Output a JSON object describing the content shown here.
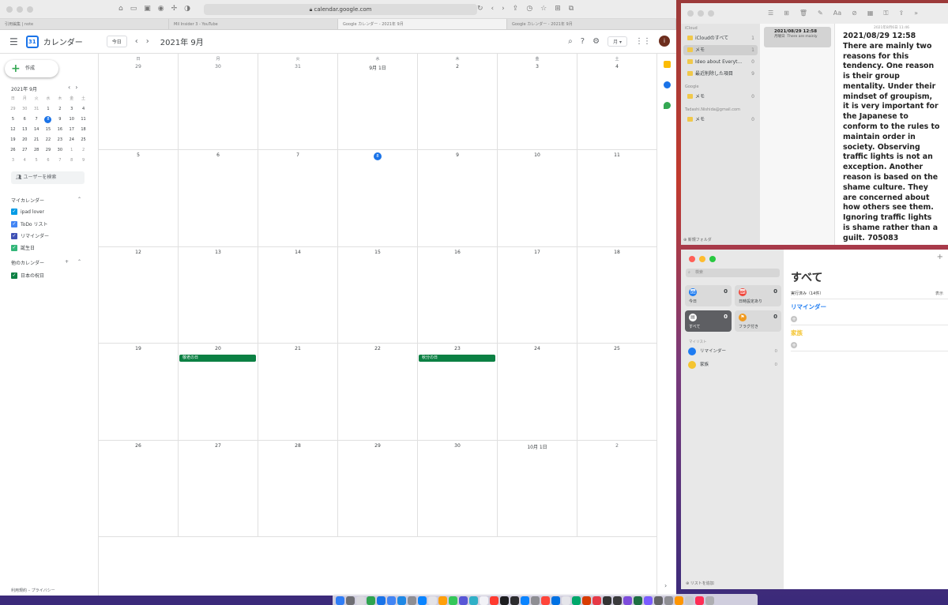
{
  "browser": {
    "url": "calendar.google.com",
    "tabs": [
      {
        "label": "引用編集 | note"
      },
      {
        "label": "Mil Insider 3 - YouTube"
      },
      {
        "label": "Google カレンダー - 2021年 9月"
      },
      {
        "label": "Google カレンダー - 2021年 9月"
      }
    ]
  },
  "gcal": {
    "app_title": "カレンダー",
    "logo_day": "31",
    "today_button": "今日",
    "month_title": "2021年 9月",
    "view_label": "月",
    "avatar_letter": "i",
    "create_label": "作成",
    "mini_title": "2021年 9月",
    "mini_days": [
      "日",
      "月",
      "火",
      "水",
      "木",
      "金",
      "土"
    ],
    "mini_weeks": [
      [
        "29",
        "30",
        "31",
        "1",
        "2",
        "3",
        "4"
      ],
      [
        "5",
        "6",
        "7",
        "8",
        "9",
        "10",
        "11"
      ],
      [
        "12",
        "13",
        "14",
        "15",
        "16",
        "17",
        "18"
      ],
      [
        "19",
        "20",
        "21",
        "22",
        "23",
        "24",
        "25"
      ],
      [
        "26",
        "27",
        "28",
        "29",
        "30",
        "1",
        "2"
      ],
      [
        "3",
        "4",
        "5",
        "6",
        "7",
        "8",
        "9"
      ]
    ],
    "search_placeholder": "ユーザーを検索",
    "my_calendars_title": "マイカレンダー",
    "my_calendars": [
      {
        "label": "ipad lover",
        "color": "#039be5"
      },
      {
        "label": "ToDo リスト",
        "color": "#4285f4"
      },
      {
        "label": "リマインダー",
        "color": "#3f51b5"
      },
      {
        "label": "誕生日",
        "color": "#33b679"
      }
    ],
    "other_calendars_title": "他のカレンダー",
    "other_calendars": [
      {
        "label": "日本の祝日",
        "color": "#0b8043"
      }
    ],
    "footer": "利用規約 – プライバシー",
    "weekdays": [
      "日",
      "月",
      "火",
      "水",
      "木",
      "金",
      "土"
    ],
    "weeks": [
      [
        "29",
        "30",
        "31",
        "9月 1日",
        "2",
        "3",
        "4"
      ],
      [
        "5",
        "6",
        "7",
        "8",
        "9",
        "10",
        "11"
      ],
      [
        "12",
        "13",
        "14",
        "15",
        "16",
        "17",
        "18"
      ],
      [
        "19",
        "20",
        "21",
        "22",
        "23",
        "24",
        "25"
      ],
      [
        "26",
        "27",
        "28",
        "29",
        "30",
        "10月 1日",
        "2"
      ]
    ],
    "today": "8",
    "events": [
      {
        "label": "敬老の日",
        "week": 3,
        "day": 1
      },
      {
        "label": "秋分の日",
        "week": 3,
        "day": 4
      }
    ],
    "colors": {
      "accent": "#1a73e8",
      "holiday": "#0b8043"
    }
  },
  "notes": {
    "groups": [
      {
        "title": "iCloud",
        "folders": [
          {
            "label": "iCloudのすべて",
            "count": "1"
          },
          {
            "label": "メモ",
            "count": "1",
            "selected": true
          },
          {
            "label": "Ideo about Everyt...",
            "count": "0"
          },
          {
            "label": "最近削除した項目",
            "count": "9"
          }
        ]
      },
      {
        "title": "Google",
        "folders": [
          {
            "label": "メモ",
            "count": "0"
          }
        ]
      },
      {
        "title": "Tadashi.Nishida@gmail.com",
        "folders": [
          {
            "label": "メモ",
            "count": "0"
          }
        ]
      }
    ],
    "new_folder": "新規フォルダ",
    "card": {
      "title": "2021/08/29 12:58",
      "day": "月曜日",
      "snippet": "There are mainly"
    },
    "date_header": "2021年8月6日 11:46",
    "content": "2021/08/29 12:58\nThere are mainly two reasons for this tendency. One reason is their group mentality. Under their mindset of groupism, it is very important for the Japanese to conform to the rules to maintain order in society. Observing traffic lights is not an exception. Another reason is based on the shame culture. They are concerned about how others see them. Ignoring traffic lights is shame rather than a guilt. 705083"
  },
  "reminders": {
    "search_placeholder": "検索",
    "tiles": [
      {
        "label": "今日",
        "count": "0",
        "color": "#1e7cf2"
      },
      {
        "label": "日時設定あり",
        "count": "0",
        "color": "#f0453a"
      },
      {
        "label": "すべて",
        "count": "0",
        "color": "#5e5f63"
      },
      {
        "label": "フラグ付き",
        "count": "0",
        "color": "#f09a1f"
      }
    ],
    "my_lists_title": "マイリスト",
    "lists": [
      {
        "label": "リマインダー",
        "count": "0",
        "color": "#1e7cf2"
      },
      {
        "label": "家族",
        "count": "0",
        "color": "#f4c430"
      }
    ],
    "add_list": "リストを追加",
    "main_title": "すべて",
    "done_label": "実行済み（14件）",
    "show_label": "表示",
    "sections": [
      {
        "label": "リマインダー",
        "color": "#1e7cf2"
      },
      {
        "label": "家族",
        "color": "#f4c430"
      }
    ]
  }
}
